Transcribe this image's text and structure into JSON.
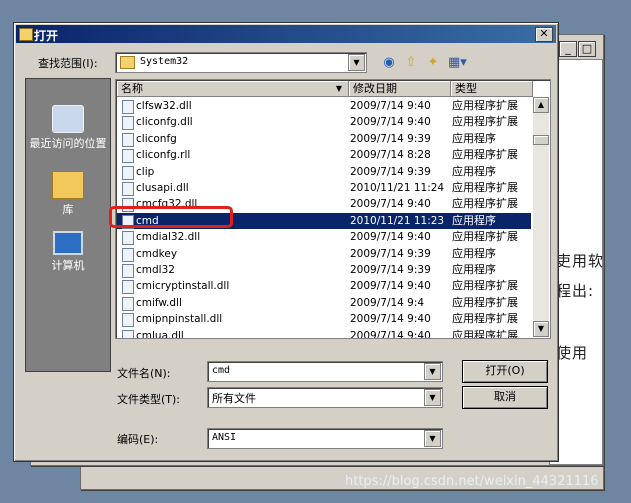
{
  "dialog": {
    "title": "打开",
    "close_glyph": "✕",
    "lookin_label": "查找范围(I):",
    "lookin_value": "System32",
    "columns": [
      "名称",
      "修改日期",
      "类型"
    ],
    "files": [
      {
        "name": "clfsw32.dll",
        "date": "2009/7/14 9:40",
        "type": "应用程序扩展"
      },
      {
        "name": "cliconfg.dll",
        "date": "2009/7/14 9:40",
        "type": "应用程序扩展"
      },
      {
        "name": "cliconfg",
        "date": "2009/7/14 9:39",
        "type": "应用程序"
      },
      {
        "name": "cliconfg.rll",
        "date": "2009/7/14 8:28",
        "type": "应用程序扩展"
      },
      {
        "name": "clip",
        "date": "2009/7/14 9:39",
        "type": "应用程序"
      },
      {
        "name": "clusapi.dll",
        "date": "2010/11/21 11:24",
        "type": "应用程序扩展"
      },
      {
        "name": "cmcfg32.dll",
        "date": "2009/7/14 9:40",
        "type": "应用程序扩展"
      },
      {
        "name": "cmd",
        "date": "2010/11/21 11:23",
        "type": "应用程序",
        "selected": true
      },
      {
        "name": "cmdial32.dll",
        "date": "2009/7/14 9:40",
        "type": "应用程序扩展"
      },
      {
        "name": "cmdkey",
        "date": "2009/7/14 9:39",
        "type": "应用程序"
      },
      {
        "name": "cmdl32",
        "date": "2009/7/14 9:39",
        "type": "应用程序"
      },
      {
        "name": "cmicryptinstall.dll",
        "date": "2009/7/14 9:40",
        "type": "应用程序扩展"
      },
      {
        "name": "cmifw.dll",
        "date": "2009/7/14 9:4",
        "type": "应用程序扩展"
      },
      {
        "name": "cmipnpinstall.dll",
        "date": "2009/7/14 9:40",
        "type": "应用程序扩展"
      },
      {
        "name": "cmlua.dll",
        "date": "2009/7/14 9:40",
        "type": "应用程序扩展"
      }
    ],
    "places": [
      {
        "label": "最近访问的位置",
        "icon": "recent-places-icon"
      },
      {
        "label": "库",
        "icon": "libraries-icon"
      },
      {
        "label": "计算机",
        "icon": "computer-icon"
      }
    ],
    "filename_label": "文件名(N):",
    "filename_value": "cmd",
    "filetype_label": "文件类型(T):",
    "filetype_value": "所有文件",
    "encoding_label": "编码(E):",
    "encoding_value": "ANSI",
    "open_button": "打开(O)",
    "cancel_button": "取消"
  },
  "background_window": {
    "text_fragments": [
      "吏用软",
      "程出:",
      "使用"
    ]
  },
  "watermark": "https://blog.csdn.net/weixin_44321116",
  "colors": {
    "selection": "#0a246a",
    "highlight_box": "#e0201c",
    "titlebar": "#0a246a"
  }
}
